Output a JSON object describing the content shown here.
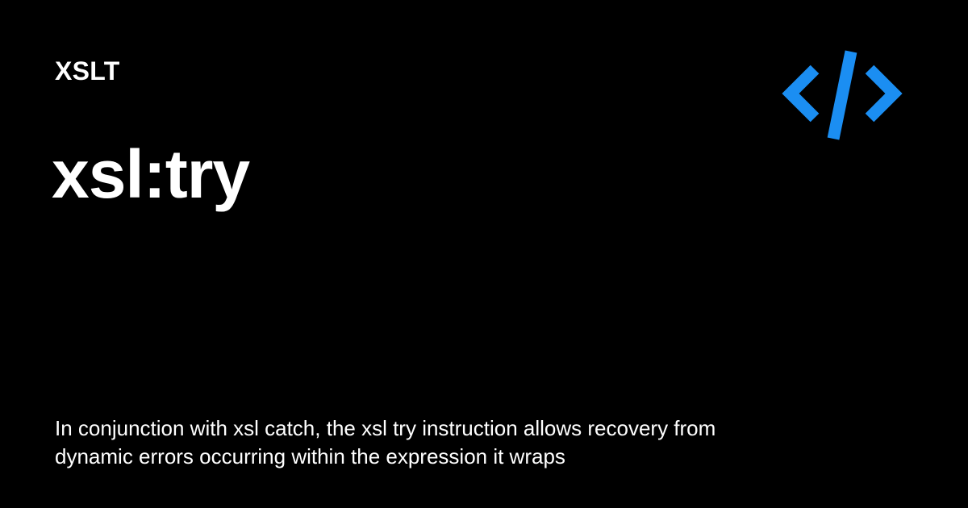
{
  "card": {
    "category": "XSLT",
    "title": "xsl:try",
    "description": "In conjunction with xsl catch, the xsl try instruction allows recovery from dynamic errors occurring within the expression it wraps"
  },
  "logo": {
    "icon": "code-brackets-icon",
    "color": "#1b8ef2"
  },
  "colors": {
    "background": "#000000",
    "text": "#ffffff",
    "accent": "#1b8ef2"
  }
}
